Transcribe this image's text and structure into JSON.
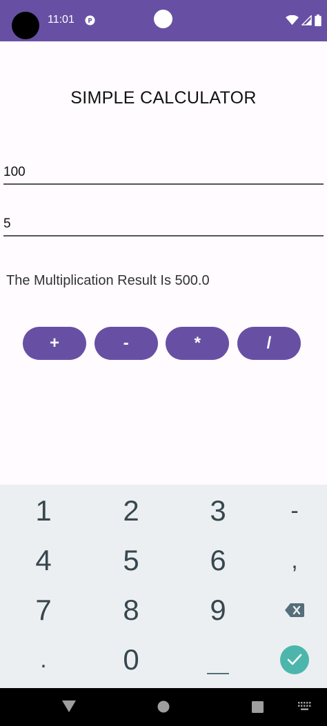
{
  "status_bar": {
    "time": "11:01",
    "background": "#6750a4",
    "icons": [
      "camera-cutout",
      "app-notification-icon",
      "wifi-icon",
      "cell-signal-icon",
      "battery-icon"
    ]
  },
  "title": "SIMPLE CALCULATOR",
  "inputs": {
    "first_value": "100",
    "second_value": "5"
  },
  "result": "The Multiplication Result Is 500.0",
  "buttons": {
    "add": "+",
    "subtract": "-",
    "multiply": "*",
    "divide": "/",
    "color": "#6750a4"
  },
  "keyboard": {
    "keys": [
      [
        "1",
        "2",
        "3",
        "-"
      ],
      [
        "4",
        "5",
        "6",
        ","
      ],
      [
        "7",
        "8",
        "9",
        "backspace-icon"
      ],
      [
        ".",
        "0",
        "space",
        "done-icon"
      ]
    ],
    "accent": "#4db6ac"
  },
  "nav_bar": {
    "icons": [
      "back-icon",
      "home-icon",
      "recents-icon",
      "keyboard-switch-icon"
    ]
  }
}
